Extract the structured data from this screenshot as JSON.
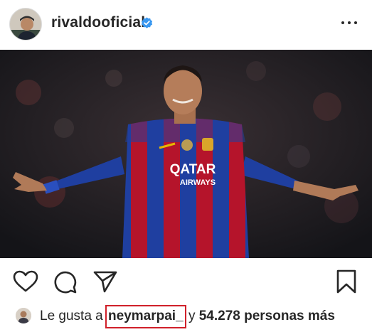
{
  "post": {
    "username": "rivaldooficial",
    "verified_icon": "verified-badge-icon",
    "more_icon": "more-options-icon",
    "photo_text": {
      "sponsor_line1": "QATAR",
      "sponsor_line2": "AIRWAYS"
    }
  },
  "actions": {
    "icons": [
      "heart-icon",
      "comment-icon",
      "share-icon",
      "bookmark-icon"
    ]
  },
  "likes": {
    "prefix": "Le gusta a",
    "liker": "neymarpai_",
    "conjunction": "y",
    "others": "54.278 personas más"
  },
  "colors": {
    "verified_blue": "#3897f0",
    "highlight_red": "#d0202a",
    "barca_blue": "#1f3fa0",
    "barca_red": "#b5142b"
  }
}
